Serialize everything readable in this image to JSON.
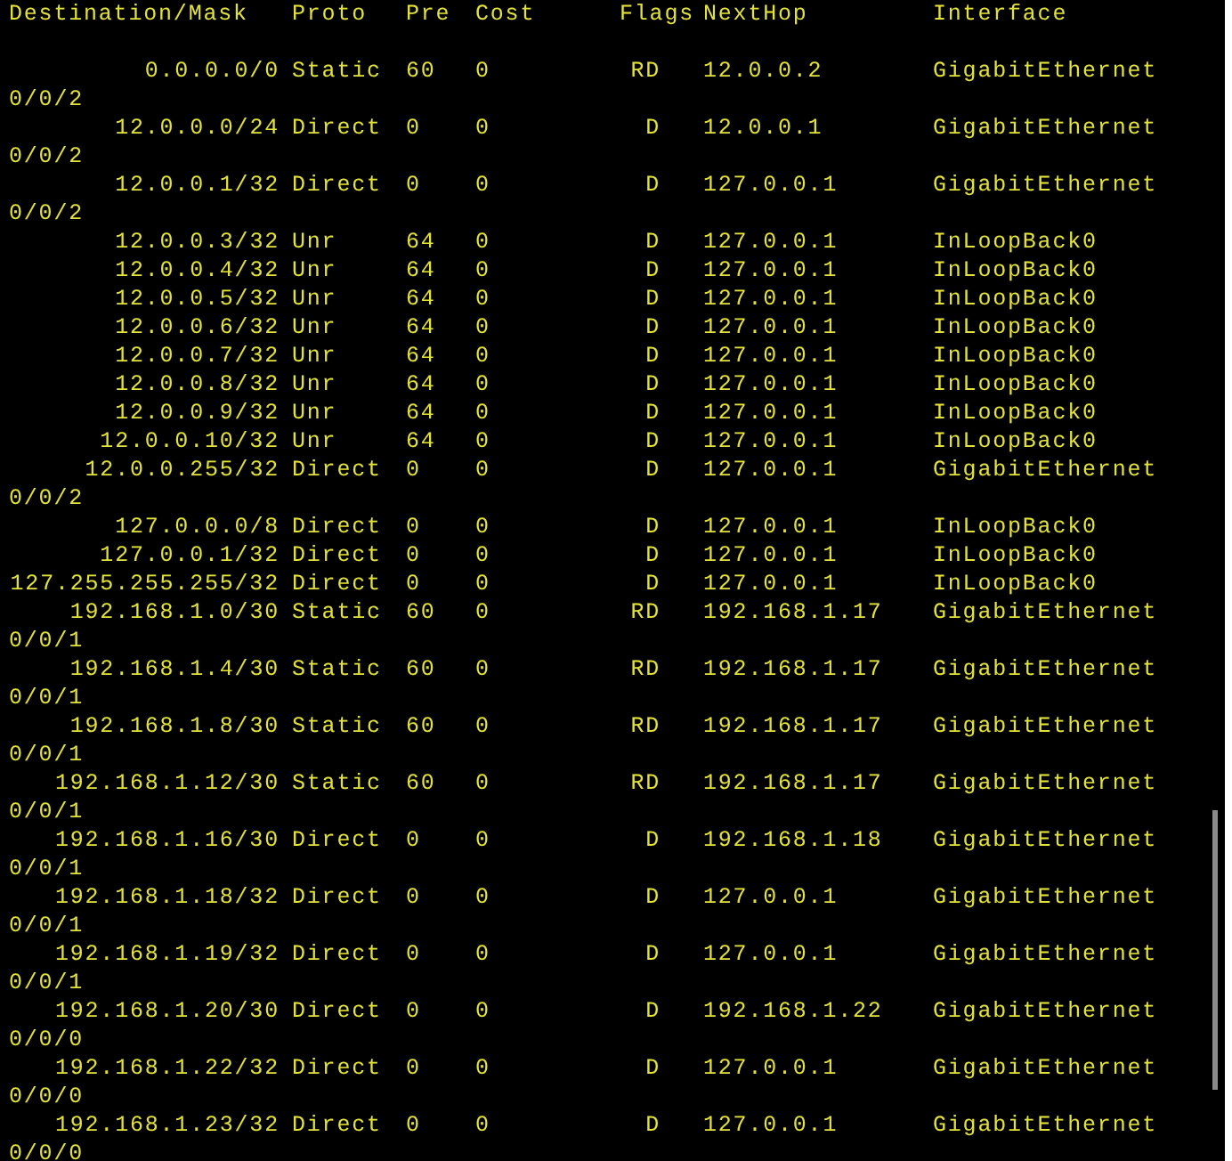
{
  "header": {
    "destination": "Destination/Mask",
    "proto": "Proto",
    "pre": "Pre",
    "cost": "Cost",
    "flags": "Flags",
    "nexthop": "NextHop",
    "interface": "Interface"
  },
  "routes": [
    {
      "destination": "0.0.0.0/0",
      "proto": "Static",
      "pre": "60",
      "cost": "0",
      "flags": "RD",
      "nexthop": "12.0.0.2",
      "interface": "GigabitEthernet",
      "interface_cont": "0/0/2"
    },
    {
      "destination": "12.0.0.0/24",
      "proto": "Direct",
      "pre": "0",
      "cost": "0",
      "flags": "D",
      "nexthop": "12.0.0.1",
      "interface": "GigabitEthernet",
      "interface_cont": "0/0/2"
    },
    {
      "destination": "12.0.0.1/32",
      "proto": "Direct",
      "pre": "0",
      "cost": "0",
      "flags": "D",
      "nexthop": "127.0.0.1",
      "interface": "GigabitEthernet",
      "interface_cont": "0/0/2"
    },
    {
      "destination": "12.0.0.3/32",
      "proto": "Unr",
      "pre": "64",
      "cost": "0",
      "flags": "D",
      "nexthop": "127.0.0.1",
      "interface": "InLoopBack0"
    },
    {
      "destination": "12.0.0.4/32",
      "proto": "Unr",
      "pre": "64",
      "cost": "0",
      "flags": "D",
      "nexthop": "127.0.0.1",
      "interface": "InLoopBack0"
    },
    {
      "destination": "12.0.0.5/32",
      "proto": "Unr",
      "pre": "64",
      "cost": "0",
      "flags": "D",
      "nexthop": "127.0.0.1",
      "interface": "InLoopBack0"
    },
    {
      "destination": "12.0.0.6/32",
      "proto": "Unr",
      "pre": "64",
      "cost": "0",
      "flags": "D",
      "nexthop": "127.0.0.1",
      "interface": "InLoopBack0"
    },
    {
      "destination": "12.0.0.7/32",
      "proto": "Unr",
      "pre": "64",
      "cost": "0",
      "flags": "D",
      "nexthop": "127.0.0.1",
      "interface": "InLoopBack0"
    },
    {
      "destination": "12.0.0.8/32",
      "proto": "Unr",
      "pre": "64",
      "cost": "0",
      "flags": "D",
      "nexthop": "127.0.0.1",
      "interface": "InLoopBack0"
    },
    {
      "destination": "12.0.0.9/32",
      "proto": "Unr",
      "pre": "64",
      "cost": "0",
      "flags": "D",
      "nexthop": "127.0.0.1",
      "interface": "InLoopBack0"
    },
    {
      "destination": "12.0.0.10/32",
      "proto": "Unr",
      "pre": "64",
      "cost": "0",
      "flags": "D",
      "nexthop": "127.0.0.1",
      "interface": "InLoopBack0"
    },
    {
      "destination": "12.0.0.255/32",
      "proto": "Direct",
      "pre": "0",
      "cost": "0",
      "flags": "D",
      "nexthop": "127.0.0.1",
      "interface": "GigabitEthernet",
      "interface_cont": "0/0/2"
    },
    {
      "destination": "127.0.0.0/8",
      "proto": "Direct",
      "pre": "0",
      "cost": "0",
      "flags": "D",
      "nexthop": "127.0.0.1",
      "interface": "InLoopBack0"
    },
    {
      "destination": "127.0.0.1/32",
      "proto": "Direct",
      "pre": "0",
      "cost": "0",
      "flags": "D",
      "nexthop": "127.0.0.1",
      "interface": "InLoopBack0"
    },
    {
      "destination": "127.255.255.255/32",
      "proto": "Direct",
      "pre": "0",
      "cost": "0",
      "flags": "D",
      "nexthop": "127.0.0.1",
      "interface": "InLoopBack0"
    },
    {
      "destination": "192.168.1.0/30",
      "proto": "Static",
      "pre": "60",
      "cost": "0",
      "flags": "RD",
      "nexthop": "192.168.1.17",
      "interface": "GigabitEthernet",
      "interface_cont": "0/0/1"
    },
    {
      "destination": "192.168.1.4/30",
      "proto": "Static",
      "pre": "60",
      "cost": "0",
      "flags": "RD",
      "nexthop": "192.168.1.17",
      "interface": "GigabitEthernet",
      "interface_cont": "0/0/1"
    },
    {
      "destination": "192.168.1.8/30",
      "proto": "Static",
      "pre": "60",
      "cost": "0",
      "flags": "RD",
      "nexthop": "192.168.1.17",
      "interface": "GigabitEthernet",
      "interface_cont": "0/0/1"
    },
    {
      "destination": "192.168.1.12/30",
      "proto": "Static",
      "pre": "60",
      "cost": "0",
      "flags": "RD",
      "nexthop": "192.168.1.17",
      "interface": "GigabitEthernet",
      "interface_cont": "0/0/1"
    },
    {
      "destination": "192.168.1.16/30",
      "proto": "Direct",
      "pre": "0",
      "cost": "0",
      "flags": "D",
      "nexthop": "192.168.1.18",
      "interface": "GigabitEthernet",
      "interface_cont": "0/0/1"
    },
    {
      "destination": "192.168.1.18/32",
      "proto": "Direct",
      "pre": "0",
      "cost": "0",
      "flags": "D",
      "nexthop": "127.0.0.1",
      "interface": "GigabitEthernet",
      "interface_cont": "0/0/1"
    },
    {
      "destination": "192.168.1.19/32",
      "proto": "Direct",
      "pre": "0",
      "cost": "0",
      "flags": "D",
      "nexthop": "127.0.0.1",
      "interface": "GigabitEthernet",
      "interface_cont": "0/0/1"
    },
    {
      "destination": "192.168.1.20/30",
      "proto": "Direct",
      "pre": "0",
      "cost": "0",
      "flags": "D",
      "nexthop": "192.168.1.22",
      "interface": "GigabitEthernet",
      "interface_cont": "0/0/0"
    },
    {
      "destination": "192.168.1.22/32",
      "proto": "Direct",
      "pre": "0",
      "cost": "0",
      "flags": "D",
      "nexthop": "127.0.0.1",
      "interface": "GigabitEthernet",
      "interface_cont": "0/0/0"
    },
    {
      "destination": "192.168.1.23/32",
      "proto": "Direct",
      "pre": "0",
      "cost": "0",
      "flags": "D",
      "nexthop": "127.0.0.1",
      "interface": "GigabitEthernet",
      "interface_cont": "0/0/0"
    }
  ]
}
